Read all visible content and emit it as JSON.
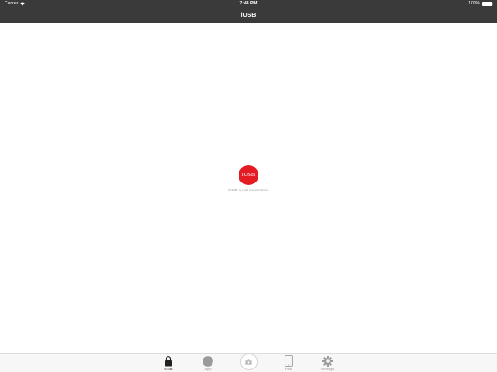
{
  "status_bar": {
    "carrier": "Carrier",
    "time": "7:48 PM",
    "battery": "100%"
  },
  "nav": {
    "title": "iUSB"
  },
  "main": {
    "logo_text": "iUSB",
    "status_text": "iUSB is not connected."
  },
  "tab_bar": {
    "items": [
      {
        "label": "iUSB",
        "icon": "lock-icon",
        "active": true
      },
      {
        "label": "App",
        "icon": "app-circle-icon",
        "active": false
      },
      {
        "label": "",
        "icon": "camera-icon",
        "active": false
      },
      {
        "label": "iPad",
        "icon": "ipad-icon",
        "active": false
      },
      {
        "label": "Settings",
        "icon": "gear-icon",
        "active": false
      }
    ]
  },
  "colors": {
    "nav_background": "#3a3a3a",
    "logo_red": "#e41b23",
    "tab_inactive": "#9a9a9a",
    "tab_active": "#222222"
  }
}
